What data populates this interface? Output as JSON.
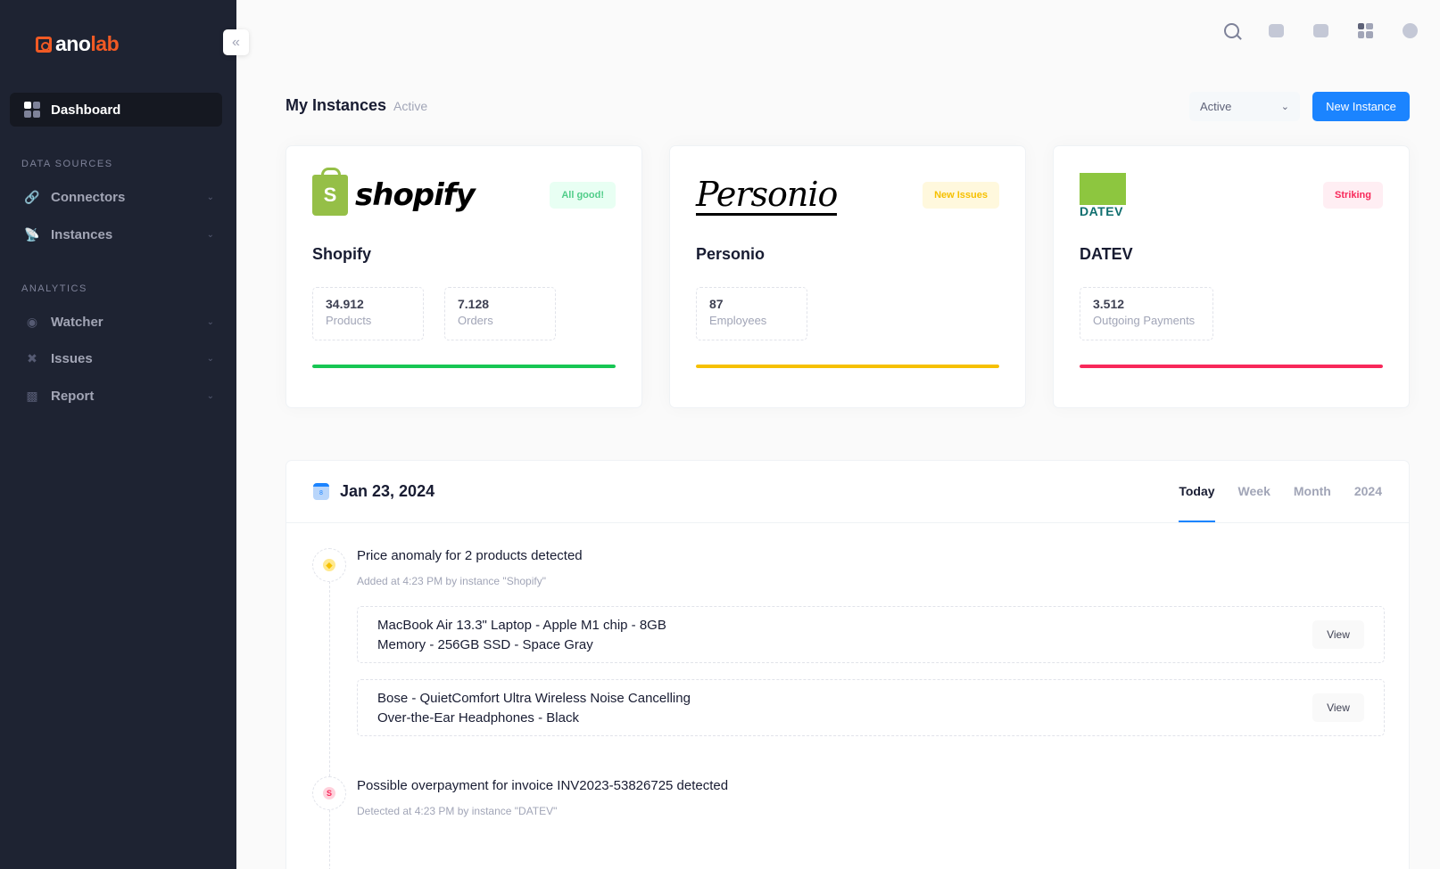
{
  "brand": {
    "part1": "ano",
    "part2": "lab"
  },
  "sidebar": {
    "active_item": "Dashboard",
    "sections": [
      {
        "label": "DATA SOURCES",
        "items": [
          {
            "label": "Connectors"
          },
          {
            "label": "Instances"
          }
        ]
      },
      {
        "label": "ANALYTICS",
        "items": [
          {
            "label": "Watcher"
          },
          {
            "label": "Issues"
          },
          {
            "label": "Report"
          }
        ]
      }
    ]
  },
  "header": {
    "title": "My Instances",
    "subtitle": "Active",
    "filter_value": "Active",
    "new_button": "New Instance"
  },
  "instances": [
    {
      "logo_text": "shopify",
      "logo_bag_letter": "S",
      "name": "Shopify",
      "badge": "All good!",
      "badge_color": "#50cd89",
      "badge_bg": "#e8fff3",
      "stats": [
        {
          "value": "34.912",
          "label": "Products"
        },
        {
          "value": "7.128",
          "label": "Orders"
        }
      ],
      "progress": 100,
      "progress_color": "#17c653"
    },
    {
      "logo_text": "Personio",
      "name": "Personio",
      "badge": "New Issues",
      "badge_color": "#f6c000",
      "badge_bg": "#fff8dd",
      "stats": [
        {
          "value": "87",
          "label": "Employees"
        }
      ],
      "progress": 100,
      "progress_color": "#f6c000"
    },
    {
      "logo_text": "DATEV",
      "name": "DATEV",
      "badge": "Striking",
      "badge_color": "#f8285a",
      "badge_bg": "#ffeef3",
      "stats": [
        {
          "value": "3.512",
          "label": "Outgoing Payments"
        }
      ],
      "progress": 100,
      "progress_color": "#f8285a"
    }
  ],
  "timeline": {
    "calendar_day": "8",
    "date": "Jan 23, 2024",
    "tabs": [
      "Today",
      "Week",
      "Month",
      "2024"
    ],
    "active_tab": "Today",
    "events": [
      {
        "title": "Price anomaly for 2 products detected",
        "meta": "Added at 4:23 PM by instance \"Shopify\"",
        "items": [
          {
            "text": "MacBook Air 13.3\" Laptop - Apple M1 chip - 8GB Memory - 256GB SSD - Space Gray",
            "action": "View"
          },
          {
            "text": "Bose - QuietComfort Ultra Wireless Noise Cancelling Over-the-Ear Headphones - Black",
            "action": "View"
          }
        ]
      },
      {
        "title": "Possible overpayment for invoice INV2023-53826725 detected",
        "meta": "Detected at 4:23 PM by instance \"DATEV\"",
        "icon_letter": "S"
      }
    ]
  },
  "colors": {
    "sidebar_bg": "#1e2332",
    "accent": "#1b84ff",
    "brand_orange": "#f15a24"
  },
  "icons": {
    "topbar": [
      "search-icon",
      "chat-icon",
      "notification-icon",
      "apps-icon",
      "user-icon"
    ]
  }
}
